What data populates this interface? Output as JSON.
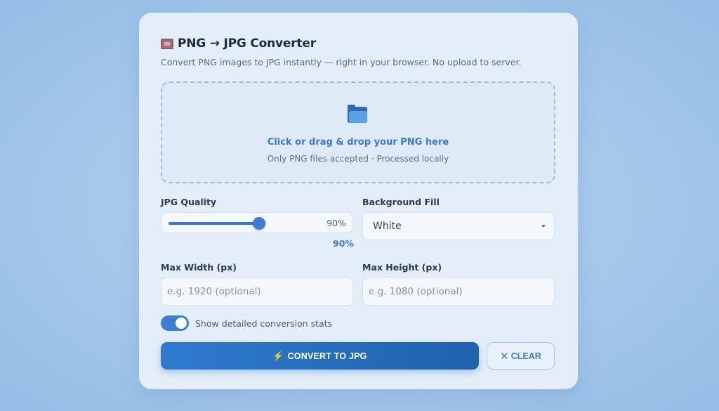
{
  "app": {
    "title": "PNG → JPG Converter",
    "subtitle": "Convert PNG images to JPG instantly — right in your browser. No upload to server."
  },
  "dropzone": {
    "main_text": "Click or drag & drop your PNG here",
    "sub_text": "Only PNG files accepted · Processed locally",
    "icon": "folder-icon"
  },
  "quality": {
    "label": "JPG Quality",
    "value_text": "90%",
    "readout": "90%",
    "value": 90
  },
  "background": {
    "label": "Background Fill",
    "selected": "White"
  },
  "max_width": {
    "label": "Max Width (px)",
    "value": "",
    "placeholder": "e.g. 1920 (optional)"
  },
  "max_height": {
    "label": "Max Height (px)",
    "value": "",
    "placeholder": "e.g. 1080 (optional)"
  },
  "stats_toggle": {
    "label": "Show detailed conversion stats",
    "on": true
  },
  "actions": {
    "convert_icon": "⚡",
    "convert_label": "CONVERT TO JPG",
    "clear_icon": "✕",
    "clear_label": "CLEAR"
  },
  "colors": {
    "accent": "#3a7fd0",
    "brand_dark": "#1f62ad",
    "text_link": "#3a7ac4"
  }
}
